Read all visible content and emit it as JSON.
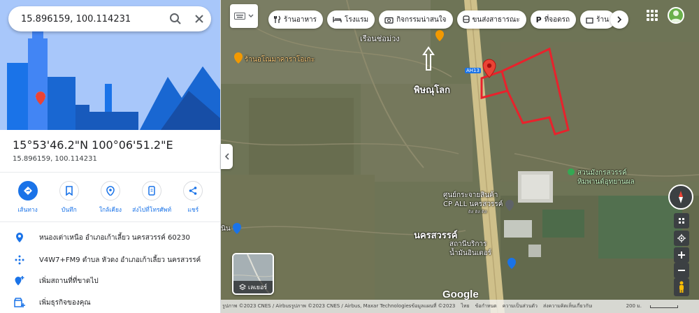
{
  "search": {
    "value": "15.896159, 100.114231"
  },
  "place": {
    "title": "15°53'46.2\"N 100°06'51.2\"E",
    "subtitle": "15.896159, 100.114231"
  },
  "actions": [
    {
      "label": "เส้นทาง",
      "icon": "directions-icon"
    },
    {
      "label": "บันทึก",
      "icon": "bookmark-icon"
    },
    {
      "label": "ใกล้เคียง",
      "icon": "nearby-icon"
    },
    {
      "label": "ส่งไปที่โทรศัพท์",
      "icon": "send-to-phone-icon"
    },
    {
      "label": "แชร์",
      "icon": "share-icon"
    }
  ],
  "details": [
    {
      "text": "หนองเต่าเหนือ อำเภอเก้าเลี้ยว นครสวรรค์ 60230",
      "icon": "location-pin-icon"
    },
    {
      "text": "V4W7+FM9 ตำบล หัวดง อำเภอเก้าเลี้ยว นครสวรรค์",
      "icon": "plus-code-icon"
    },
    {
      "text": "เพิ่มสถานที่ที่ขาดไป",
      "icon": "add-place-icon"
    },
    {
      "text": "เพิ่มธุรกิจของคุณ",
      "icon": "add-business-icon"
    }
  ],
  "chips": [
    {
      "label": "ร้านอาหาร",
      "icon": "restaurant-icon"
    },
    {
      "label": "โรงแรม",
      "icon": "hotel-icon"
    },
    {
      "label": "กิจกรรมน่าสนใจ",
      "icon": "camera-icon"
    },
    {
      "label": "ขนส่งสาธารณะ",
      "icon": "transit-icon"
    },
    {
      "label": "ที่จอดรถ",
      "icon": "parking-icon"
    },
    {
      "label": "ร้าน",
      "icon": "shop-icon"
    }
  ],
  "map_labels": {
    "poi_1": "เรือนช่อม่วง",
    "poi_2": "ร้านอโณมาคาราโอเกะ",
    "region_1": "พิษณุโลก",
    "region_2": "นครสวรรค์",
    "road": "AH13",
    "park_1": "สวนมังกรสวรรค์",
    "park_2": "หิมพานต์อุทยานผล",
    "dist_1": "ศูนย์กระจายสินค้า",
    "dist_2": "CP ALL นครสวรรค์",
    "dist_3": "ดิส ดิส ดิส",
    "gas_1": "สถานีบริการ",
    "gas_2": "น้ำมันอินเตอร์",
    "edge": "นิน"
  },
  "layers_label": "เลเยอร์",
  "google_logo": "Google",
  "attribution": {
    "imagery": "รูปภาพ ©2023 CNES / Airbusรูปภาพ ©2023 CNES / Airbus, Maxar Technologiesข้อมูลแผนที่ ©2023",
    "country": "ไทย",
    "terms": "ข้อกำหนด",
    "privacy": "ความเป็นส่วนตัว",
    "feedback": "ส่งความคิดเห็นเกี่ยวกับผลิตภัณฑ์",
    "scale": "200 ม."
  },
  "colors": {
    "accent": "#1a73e8",
    "pin": "#ea4335",
    "outline": "#e8222c",
    "road": "#d8c892"
  }
}
